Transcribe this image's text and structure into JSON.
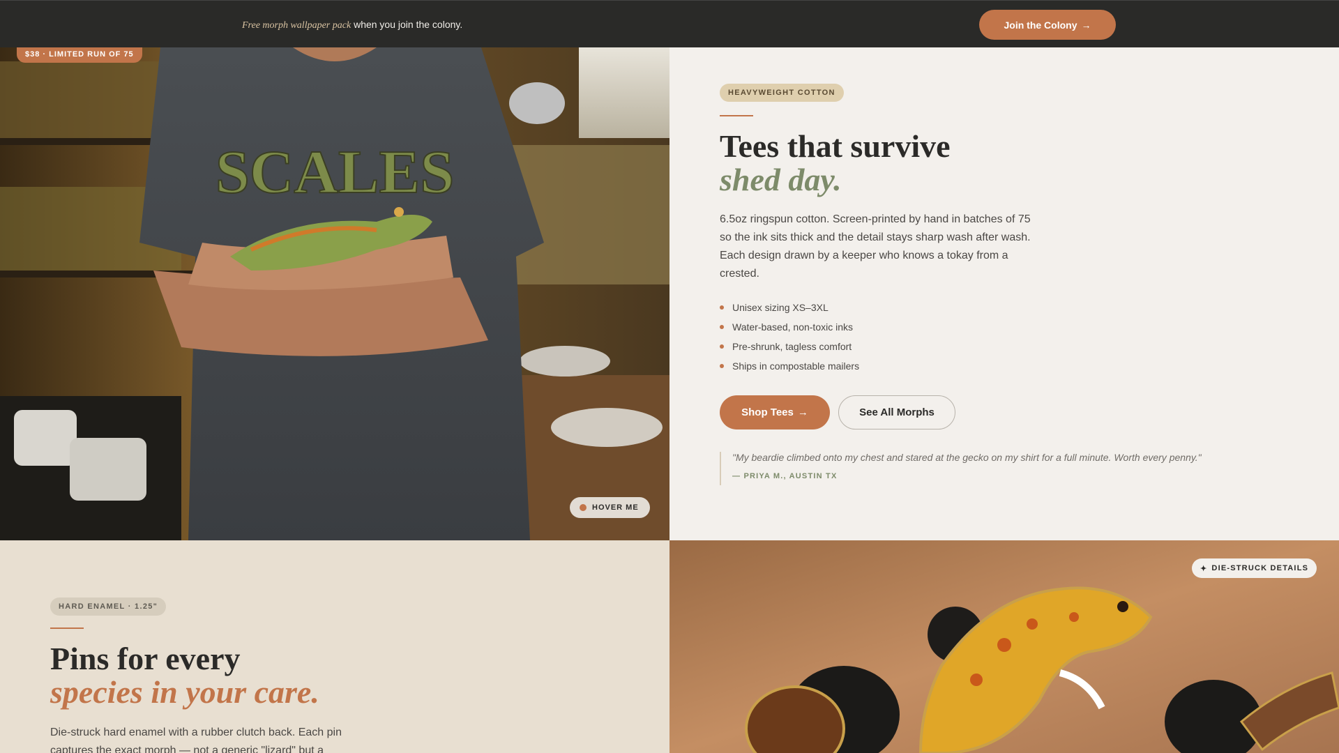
{
  "promo_bar": {
    "promo_italic": "Free morph wallpaper pack",
    "promo_text": " when you join the colony.",
    "join_label": "Join the Colony",
    "join_arrow": "→"
  },
  "tee_section": {
    "price_badge": "$38 · LIMITED RUN OF 75",
    "photo_shirt_print": "SCALES",
    "hover_label": "HOVER ME",
    "tag": "HEAVYWEIGHT COTTON",
    "heading_line1": "Tees that survive",
    "heading_line2": "shed day.",
    "description": "6.5oz ringspun cotton. Screen-printed by hand in batches of 75 so the ink sits thick and the detail stays sharp wash after wash. Each design drawn by a keeper who knows a tokay from a crested.",
    "features": [
      "Unisex sizing XS–3XL",
      "Water-based, non-toxic inks",
      "Pre-shrunk, tagless comfort",
      "Ships in compostable mailers"
    ],
    "shop_label": "Shop Tees",
    "shop_arrow": "→",
    "morphs_label": "See All Morphs",
    "quote": "\"My beardie climbed onto my chest and stared at the gecko on my shirt for a full minute. Worth every penny.\"",
    "quote_author": "— PRIYA M., AUSTIN TX"
  },
  "pins_section": {
    "tag": "HARD ENAMEL · 1.25\"",
    "heading_line1": "Pins for every",
    "heading_line2": "species in your care.",
    "description": "Die-struck hard enamel with a rubber clutch back. Each pin captures the exact morph — not a generic \"lizard\" but a",
    "die_badge": "DIE-STRUCK DETAILS",
    "die_icon": "✦"
  },
  "colors": {
    "accent": "#c2754a",
    "sage": "#7d8b6a",
    "dark": "#2a2a28",
    "cream": "#f3f0ec",
    "sand": "#e8dfd1"
  }
}
